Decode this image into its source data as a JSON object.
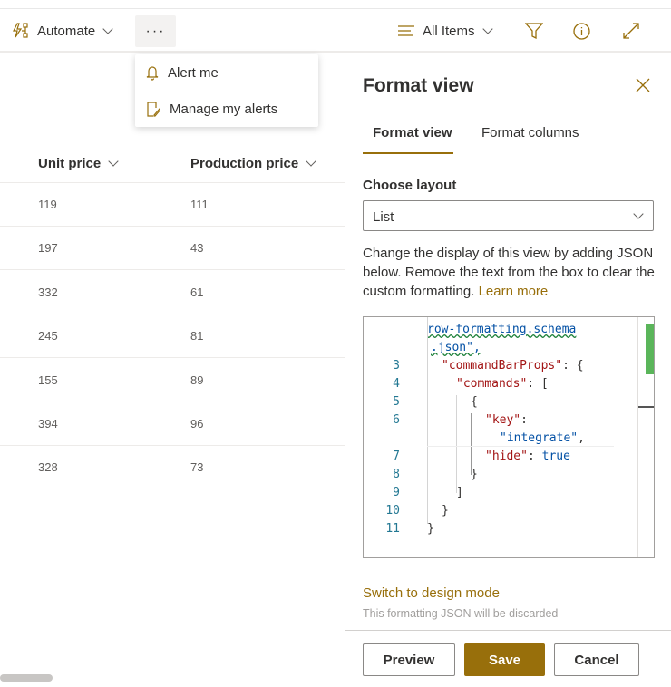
{
  "toolbar": {
    "automate": "Automate",
    "more": "···",
    "view": "All Items",
    "icons": [
      "automate-icon",
      "list-icon",
      "filter-icon",
      "info-icon",
      "expand-icon"
    ]
  },
  "menu": {
    "items": [
      {
        "label": "Alert me",
        "icon": "bell-icon"
      },
      {
        "label": "Manage my alerts",
        "icon": "manage-alerts-icon"
      }
    ]
  },
  "list": {
    "columns": [
      "Unit price",
      "Production price"
    ],
    "rows": [
      [
        "119",
        "111"
      ],
      [
        "197",
        "43"
      ],
      [
        "332",
        "61"
      ],
      [
        "245",
        "81"
      ],
      [
        "155",
        "89"
      ],
      [
        "394",
        "96"
      ],
      [
        "328",
        "73"
      ]
    ]
  },
  "panel": {
    "title": "Format view",
    "tabs": [
      {
        "label": "Format view",
        "active": true
      },
      {
        "label": "Format columns",
        "active": false
      }
    ],
    "layout_label": "Choose layout",
    "layout_value": "List",
    "description": "Change the display of this view by adding JSON below. Remove the text from the box to clear the custom formatting.",
    "learn_more": "Learn more",
    "code": {
      "line1a": "row-formatting.schema",
      "line1b": ".json\",",
      "l3k": "\"commandBarProps\"",
      "l3r": ": {",
      "l4k": "\"commands\"",
      "l4r": ": [",
      "l5": "{",
      "l6k": "\"key\"",
      "l6r": ":",
      "l6v": "\"integrate\"",
      "l6c": ",",
      "l7k": "\"hide\"",
      "l7r": ": ",
      "l7v": "true",
      "l8": "}",
      "l9": "]",
      "l10": "}",
      "l11": "}",
      "line_numbers": [
        "3",
        "4",
        "5",
        "6",
        "7",
        "8",
        "9",
        "10",
        "11"
      ]
    },
    "switch_mode": "Switch to design mode",
    "discard_note": "This formatting JSON will be discarded",
    "buttons": {
      "preview": "Preview",
      "save": "Save",
      "cancel": "Cancel"
    }
  },
  "colors": {
    "accent": "#986f0b"
  }
}
